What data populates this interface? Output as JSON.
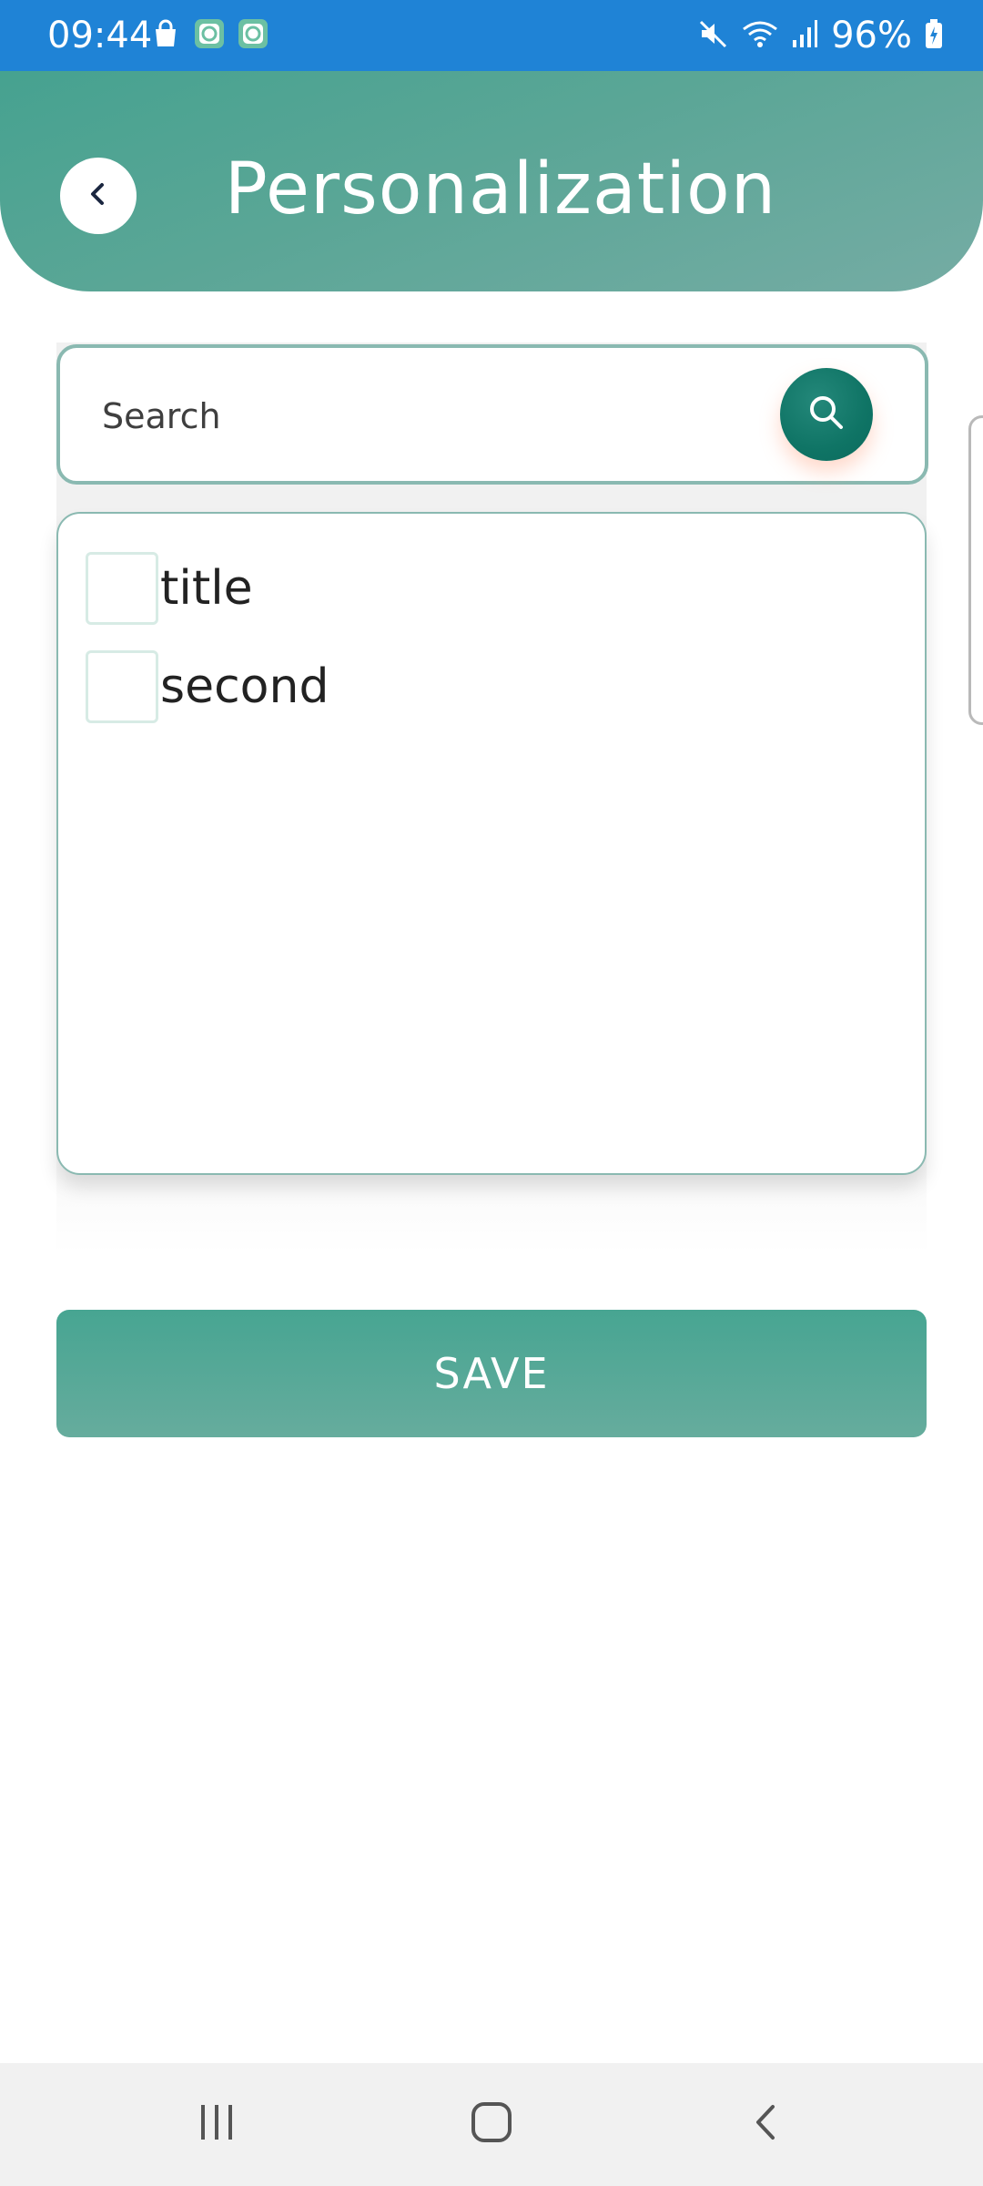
{
  "status_bar": {
    "time": "09:44",
    "battery": "96%",
    "left_icons": [
      "shopping-bag-icon",
      "app-notification-icon",
      "app-notification-icon"
    ],
    "right_icons": [
      "mute-icon",
      "wifi-icon",
      "signal-icon",
      "battery-charging-icon"
    ]
  },
  "header": {
    "title": "Personalization",
    "back_icon": "chevron-left-icon"
  },
  "search": {
    "placeholder": "Search",
    "value": "",
    "button_icon": "search-icon"
  },
  "list": {
    "items": [
      {
        "label": "title",
        "checked": false
      },
      {
        "label": "second",
        "checked": false
      }
    ]
  },
  "actions": {
    "save_label": "SAVE"
  },
  "nav_bar": {
    "buttons": [
      "recent-apps-icon",
      "home-icon",
      "back-icon"
    ]
  },
  "colors": {
    "status_bar": "#1f83d6",
    "header": "#52a593",
    "accent": "#4aa592",
    "search_button": "#0f7465",
    "border": "#8ab9b1"
  }
}
